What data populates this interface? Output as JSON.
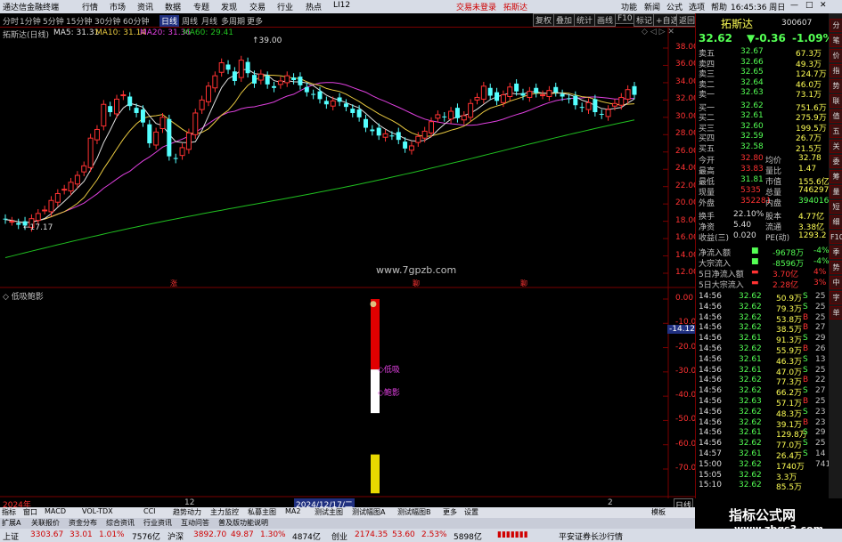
{
  "topbar": {
    "app_title": "通达信金融终端",
    "menus": [
      "行情",
      "市场",
      "资讯",
      "数据",
      "专题",
      "发现",
      "交易",
      "行业",
      "热点",
      "LI12"
    ],
    "login": "交易未登录",
    "stock": "拓斯达",
    "right_menus": [
      "功能",
      "新闻",
      "公式",
      "选项",
      "帮助"
    ],
    "time": "16:45:36 周日"
  },
  "periodbar": {
    "periods": [
      "分时",
      "1分钟",
      "5分钟",
      "15分钟",
      "30分钟",
      "60分钟",
      "日线",
      "周线",
      "月线",
      "多周期",
      "更多"
    ],
    "tools": [
      "复权",
      "叠加",
      "统计",
      "画线",
      "F10",
      "标记",
      "+自选",
      "返回"
    ]
  },
  "main_chart": {
    "legend_name": "拓斯达(日线)",
    "ma5": "MA5: 31.31",
    "ma10": "MA10: 31.14",
    "ma20": "MA20: 31.36",
    "ma60": "MA60: 29.41",
    "high_label": "39.00",
    "low_label": "17.17",
    "watermark": "www.7gpzb.com",
    "markers": [
      "涨",
      "聊",
      "聊"
    ],
    "y_ticks": [
      "38.00",
      "36.00",
      "34.00",
      "32.00",
      "30.00",
      "28.00",
      "26.00",
      "24.00",
      "22.00",
      "20.00",
      "18.00",
      "16.00",
      "14.00",
      "12.00"
    ],
    "colors": {
      "up": "#ff3232",
      "down": "#54ffff",
      "ma5": "#e0e0e0",
      "ma10": "#e8c840",
      "ma20": "#e040e0",
      "ma60": "#20c020"
    }
  },
  "sub_chart": {
    "name": "低吸鲍影",
    "labels": [
      "低吸",
      "鲍影"
    ],
    "current": "-14.12",
    "y_ticks": [
      "0.00",
      "-10.00",
      "-20.00",
      "-30.00",
      "-40.00",
      "-50.00",
      "-60.00",
      "-70.00"
    ]
  },
  "axis": {
    "left": "2024年",
    "mid1": "12",
    "date": "2024/12/17/二",
    "mid2": "2",
    "btn": "日线"
  },
  "bottom_tabs1": [
    "指标",
    "窗口",
    "MACD",
    "VOL-TDX",
    "CCI",
    "趋势动力",
    "主力监控",
    "私募主图",
    "MA2",
    "测试主图",
    "测试幅图A",
    "测试幅图B",
    "更多",
    "设置",
    "模板"
  ],
  "bottom_tabs2": [
    "扩展A",
    "关联报价",
    "资金分布",
    "综合资讯",
    "行业资讯",
    "互动问答",
    "普及版功能说明"
  ],
  "quote": {
    "name": "拓斯达",
    "code": "300607",
    "price": "32.62",
    "change": "▼-0.36",
    "pct": "-1.09%",
    "asks": [
      [
        "卖五",
        "32.67",
        "67.3万"
      ],
      [
        "卖四",
        "32.66",
        "49.3万"
      ],
      [
        "卖三",
        "32.65",
        "124.7万"
      ],
      [
        "卖二",
        "32.64",
        "46.0万"
      ],
      [
        "卖一",
        "32.63",
        "73.1万"
      ]
    ],
    "bids": [
      [
        "买一",
        "32.62",
        "751.6万"
      ],
      [
        "买二",
        "32.61",
        "275.9万"
      ],
      [
        "买三",
        "32.60",
        "199.5万"
      ],
      [
        "买四",
        "32.59",
        "26.7万"
      ],
      [
        "买五",
        "32.58",
        "21.5万"
      ]
    ],
    "stats": [
      [
        "今开",
        "32.80",
        "均价",
        "32.78"
      ],
      [
        "最高",
        "33.83",
        "量比",
        "1.47"
      ],
      [
        "最低",
        "31.81",
        "市值",
        "155.6亿"
      ],
      [
        "现量",
        "5335",
        "总量",
        "746297"
      ],
      [
        "外盘",
        "352281",
        "内盘",
        "394016"
      ]
    ],
    "stats2": [
      [
        "换手",
        "22.10%",
        "股本",
        "4.77亿"
      ],
      [
        "净资",
        "5.40",
        "流通",
        "3.38亿"
      ],
      [
        "收益(三)",
        "0.020",
        "PE(动)",
        "1293.2"
      ]
    ],
    "flows": [
      [
        "净流入额",
        "-9678万",
        "-4%"
      ],
      [
        "大宗流入",
        "-8596万",
        "-4%"
      ],
      [
        "5日净流入额",
        "3.70亿",
        "4%"
      ],
      [
        "5日大宗流入",
        "2.28亿",
        "3%"
      ]
    ],
    "ticks": [
      [
        "14:56",
        "32.62",
        "50.9万",
        "S",
        "25"
      ],
      [
        "14:56",
        "32.62",
        "79.3万",
        "S",
        "25"
      ],
      [
        "14:56",
        "32.62",
        "53.8万",
        "B",
        "25"
      ],
      [
        "14:56",
        "32.62",
        "38.5万",
        "B",
        "27"
      ],
      [
        "14:56",
        "32.61",
        "91.3万",
        "S",
        "29"
      ],
      [
        "14:56",
        "32.62",
        "55.9万",
        "B",
        "26"
      ],
      [
        "14:56",
        "32.61",
        "46.3万",
        "S",
        "13"
      ],
      [
        "14:56",
        "32.61",
        "47.0万",
        "S",
        "25"
      ],
      [
        "14:56",
        "32.62",
        "77.3万",
        "B",
        "22"
      ],
      [
        "14:56",
        "32.62",
        "66.2万",
        "S",
        "27"
      ],
      [
        "14:56",
        "32.63",
        "57.1万",
        "B",
        "25"
      ],
      [
        "14:56",
        "32.62",
        "48.3万",
        "S",
        "23"
      ],
      [
        "14:56",
        "32.62",
        "39.1万",
        "B",
        "23"
      ],
      [
        "14:56",
        "32.61",
        "129.8万",
        "S",
        "29"
      ],
      [
        "14:56",
        "32.62",
        "77.0万",
        "S",
        "25"
      ],
      [
        "14:57",
        "32.61",
        "26.4万",
        "S",
        "14"
      ],
      [
        "15:00",
        "32.62",
        "1740万",
        "",
        "741"
      ],
      [
        "15:05",
        "32.62",
        "3.3万",
        "",
        ""
      ],
      [
        "15:10",
        "32.62",
        "85.5万",
        "",
        ""
      ]
    ]
  },
  "side_tabs": [
    "分",
    "笔",
    "价",
    "指",
    "势",
    "联",
    "值",
    "五",
    "关",
    "委",
    "筹",
    "量",
    "短",
    "细",
    "F10",
    "季",
    "势",
    "中",
    "字",
    "单"
  ],
  "status": {
    "sh": "上证",
    "sh_val": "3303.67",
    "sh_chg": "33.01",
    "sh_pct": "1.01%",
    "sh_amt": "7576亿",
    "sz": "沪深",
    "sz_val": "3892.70",
    "sz_chg": "49.87",
    "sz_pct": "1.30%",
    "sz_amt": "4874亿",
    "cy": "创业",
    "cy_val": "2174.35",
    "cy_chg": "53.60",
    "cy_pct": "2.53%",
    "cy_amt": "5898亿",
    "broker": "平安证券长沙行情"
  },
  "logo": {
    "title": "指标公式网",
    "url": "www.zbgs3.com"
  }
}
